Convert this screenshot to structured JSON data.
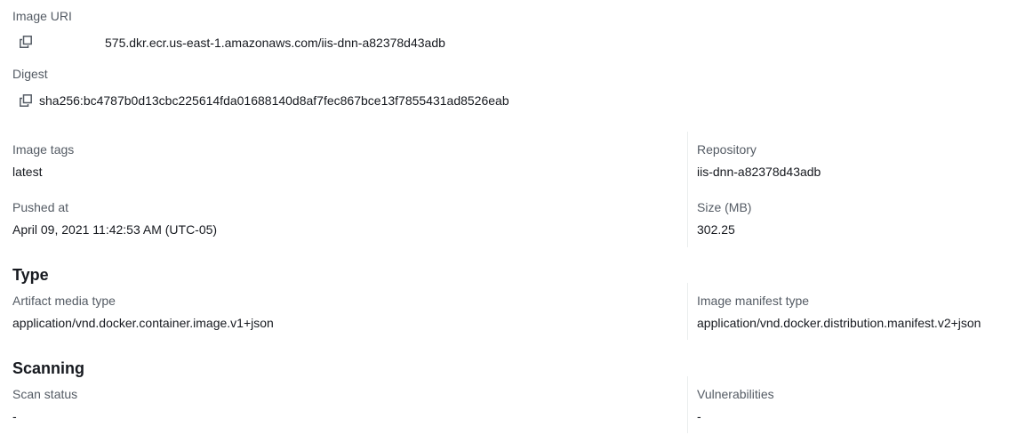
{
  "image_uri": {
    "label": "Image URI",
    "value": "575.dkr.ecr.us-east-1.amazonaws.com/iis-dnn-a82378d43adb",
    "copy_icon": "copy-icon"
  },
  "digest": {
    "label": "Digest",
    "value": "sha256:bc4787b0d13cbc225614fda01688140d8af7fec867bce13f7855431ad8526eab",
    "copy_icon": "copy-icon"
  },
  "details": {
    "image_tags": {
      "label": "Image tags",
      "value": "latest"
    },
    "repository": {
      "label": "Repository",
      "value": "iis-dnn-a82378d43adb"
    },
    "pushed_at": {
      "label": "Pushed at",
      "value": "April 09, 2021 11:42:53 AM (UTC-05)"
    },
    "size": {
      "label": "Size (MB)",
      "value": "302.25"
    }
  },
  "type_section": {
    "heading": "Type",
    "artifact_media_type": {
      "label": "Artifact media type",
      "value": "application/vnd.docker.container.image.v1+json"
    },
    "image_manifest_type": {
      "label": "Image manifest type",
      "value": "application/vnd.docker.distribution.manifest.v2+json"
    }
  },
  "scanning_section": {
    "heading": "Scanning",
    "scan_status": {
      "label": "Scan status",
      "value": "-"
    },
    "vulnerabilities": {
      "label": "Vulnerabilities",
      "value": "-"
    }
  }
}
